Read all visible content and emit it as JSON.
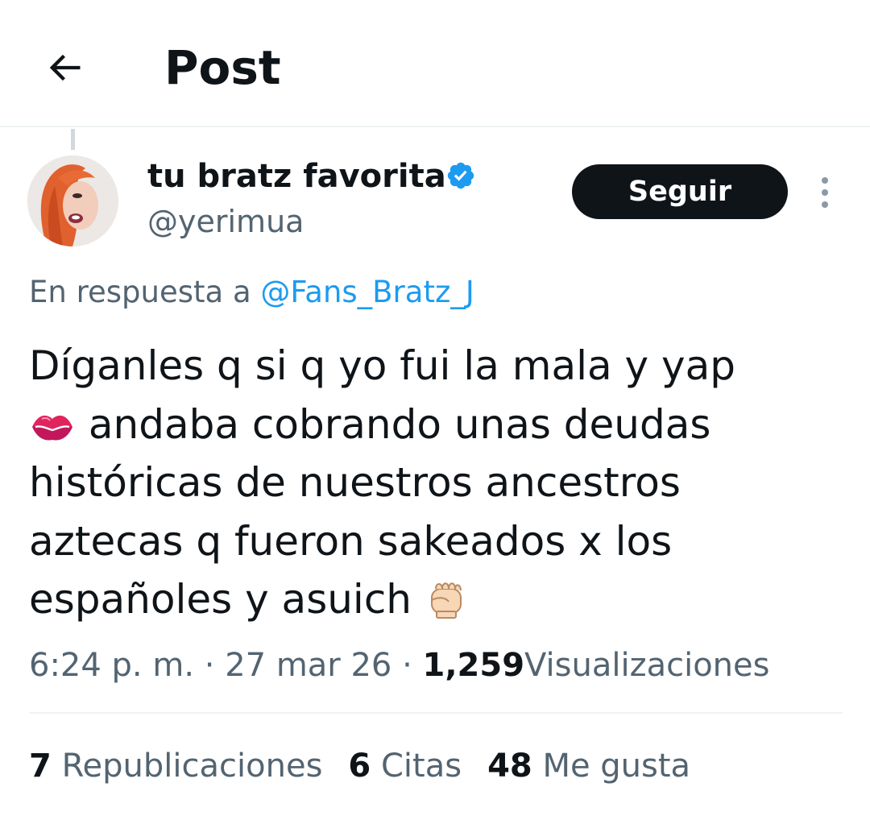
{
  "header": {
    "title": "Post",
    "back_icon": "arrow-left-icon"
  },
  "author": {
    "display_name": "tu bratz favorita",
    "handle": "@yerimua",
    "verified_icon": "verified-badge-icon",
    "verified_color": "#1d9bf0"
  },
  "actions": {
    "follow_label": "Seguir",
    "more_icon": "more-vertical-icon"
  },
  "reply": {
    "prefix": "En respuesta a",
    "mention": "@Fans_Bratz_J"
  },
  "post": {
    "lines": [
      "Díganles q si q yo fui la mala y yap",
      "andaba cobrando unas deudas",
      "históricas de nuestros ancestros",
      "aztecas q fueron sakeados x los",
      "españoles y asuich"
    ],
    "emojis": [
      "kiss-mark-emoji",
      "raised-fist-emoji"
    ]
  },
  "meta": {
    "time": "6:24 p. m.",
    "separator": "·",
    "date": "27 mar 26",
    "views_count": "1,259",
    "views_label": "Visualizaciones"
  },
  "stats": [
    {
      "count": "7",
      "label": "Republicaciones"
    },
    {
      "count": "6",
      "label": "Citas"
    },
    {
      "count": "48",
      "label": "Me gusta"
    }
  ],
  "colors": {
    "text": "#0f1419",
    "secondary": "#536471",
    "link": "#1d9bf0",
    "follow_bg": "#0f1419",
    "border": "#eff3f4"
  }
}
